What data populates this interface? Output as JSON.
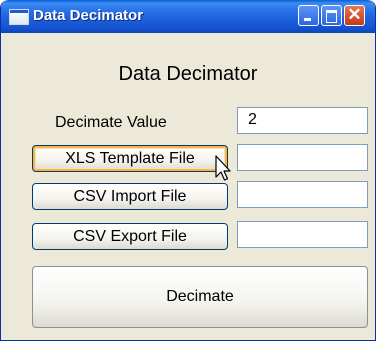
{
  "window": {
    "title": "Data Decimator"
  },
  "form": {
    "heading": "Data Decimator",
    "decimate_label": "Decimate Value",
    "decimate_value": "2",
    "xls_template_button": "XLS Template File",
    "xls_template_path": "",
    "csv_import_button": "CSV Import File",
    "csv_import_path": "",
    "csv_export_button": "CSV Export File",
    "csv_export_path": "",
    "decimate_button": "Decimate"
  },
  "icons": {
    "app": "window-app-icon",
    "minimize": "minimize-icon",
    "maximize": "maximize-icon",
    "close": "close-icon",
    "cursor": "mouse-pointer-icon"
  },
  "colors": {
    "titlebar": "#1c5fdb",
    "window_bg": "#ece9d8",
    "hover_highlight": "#f8b343",
    "close_button": "#c2391c"
  }
}
